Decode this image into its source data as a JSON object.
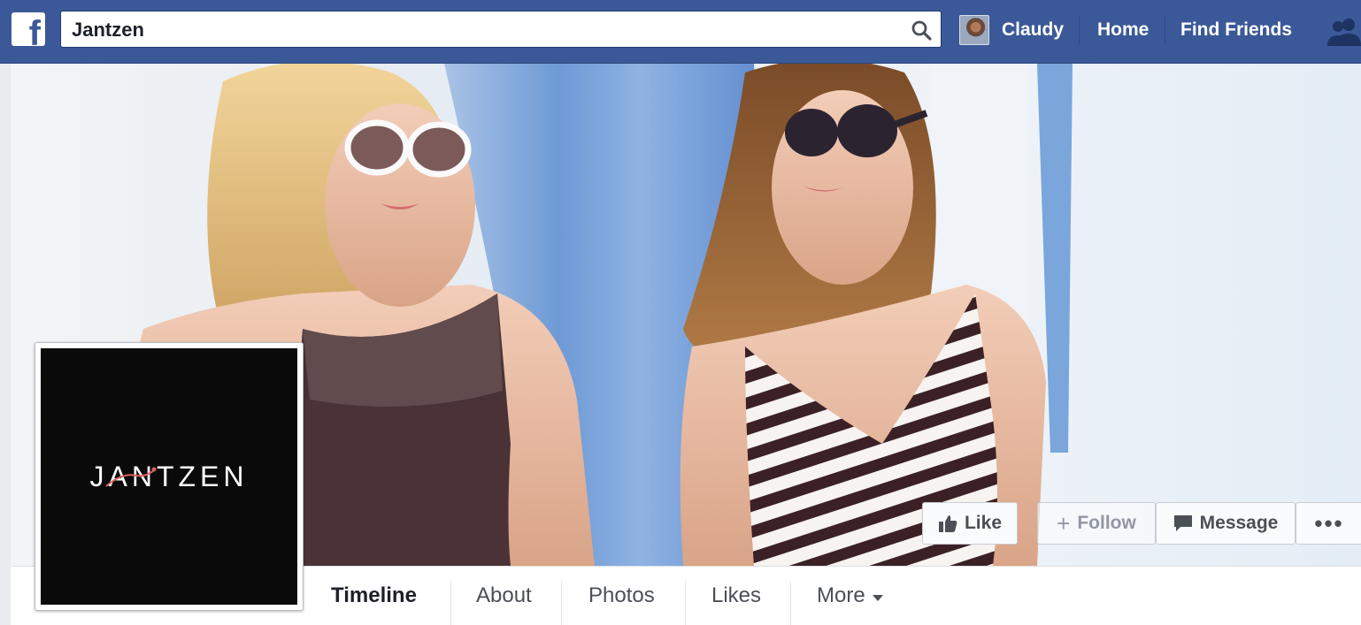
{
  "topbar": {
    "search_value": "Jantzen",
    "profile_name": "Claudy",
    "home_label": "Home",
    "find_friends_label": "Find Friends",
    "icons": [
      "facebook-logo",
      "search-icon",
      "friends-icon"
    ]
  },
  "page": {
    "brand_logo_text": "JANTZEN"
  },
  "actions": {
    "like_label": "Like",
    "follow_label": "Follow",
    "message_label": "Message",
    "more_label": "•••"
  },
  "tabs": [
    {
      "label": "Timeline",
      "active": true
    },
    {
      "label": "About"
    },
    {
      "label": "Photos"
    },
    {
      "label": "Likes"
    },
    {
      "label": "More"
    }
  ],
  "colors": {
    "facebook_blue": "#3b5998",
    "page_background": "#e9ebee"
  }
}
